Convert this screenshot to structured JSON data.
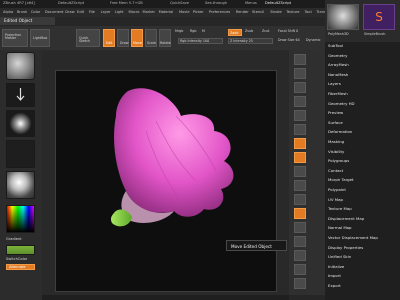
{
  "title_bar": {
    "app": "ZBrush 4R7 [x64]",
    "sub": "DefaultZScript",
    "free_mem": "Free Mem 5.7+GB",
    "quicksave": "QuickSave",
    "seethrough": "See-through",
    "menus": "Menus",
    "script": "DefaultZScript"
  },
  "menu_bar": [
    "Alpha",
    "Brush",
    "Color",
    "Document",
    "Draw",
    "Edit",
    "File",
    "Layer",
    "Light",
    "Macro",
    "Marker",
    "Material",
    "Movie",
    "Picker",
    "Preferences",
    "Render",
    "Stencil",
    "Stroke",
    "Texture",
    "Tool",
    "Transform",
    "Zplugin",
    "Zscript"
  ],
  "active_subtool": "Edited Object",
  "shelf": {
    "projection_master": "Projection Master",
    "lightbox": "LightBox",
    "quick_sketch": "Quick Sketch",
    "edit": "Edit",
    "draw": "Draw",
    "move": "Move",
    "scale": "Scale",
    "rotate": "Rotate",
    "mrgb": "Mrgb",
    "rgb": "Rgb",
    "m": "M",
    "zadd": "Zadd",
    "zsub": "Zsub",
    "zcut": "Zcut",
    "focal_shift": "Focal Shift 0",
    "draw_size": "Draw Size 64",
    "rgb_intensity": "Rgb Intensity 100",
    "z_intensity": "Z Intensity 25",
    "dynamic": "Dynamic"
  },
  "left_panel": {
    "gradient": "Gradient",
    "switch_color": "SwitchColor",
    "alternate": "Alternate"
  },
  "right_tray_menu": [
    "SubTool",
    "Geometry",
    "ArrayMesh",
    "NanoMesh",
    "Layers",
    "FiberMesh",
    "Geometry HD",
    "Preview",
    "Surface",
    "Deformation",
    "Masking",
    "Visibility",
    "Polygroups",
    "Contact",
    "Morph Target",
    "Polypaint",
    "UV Map",
    "Texture Map",
    "Displacement Map",
    "Normal Map",
    "Vector Displacement Map",
    "Display Properties",
    "Unified Skin",
    "Initialize",
    "Import",
    "Export"
  ],
  "tray_head": {
    "tool_label": "PolyMesh3D",
    "tool2_label": "SimpleBrush"
  },
  "tooltip": "Move Edited Object",
  "colors": {
    "accent_orange": "#e37b22",
    "object_pink": "#e255c8",
    "object_green": "#7bd43a"
  }
}
